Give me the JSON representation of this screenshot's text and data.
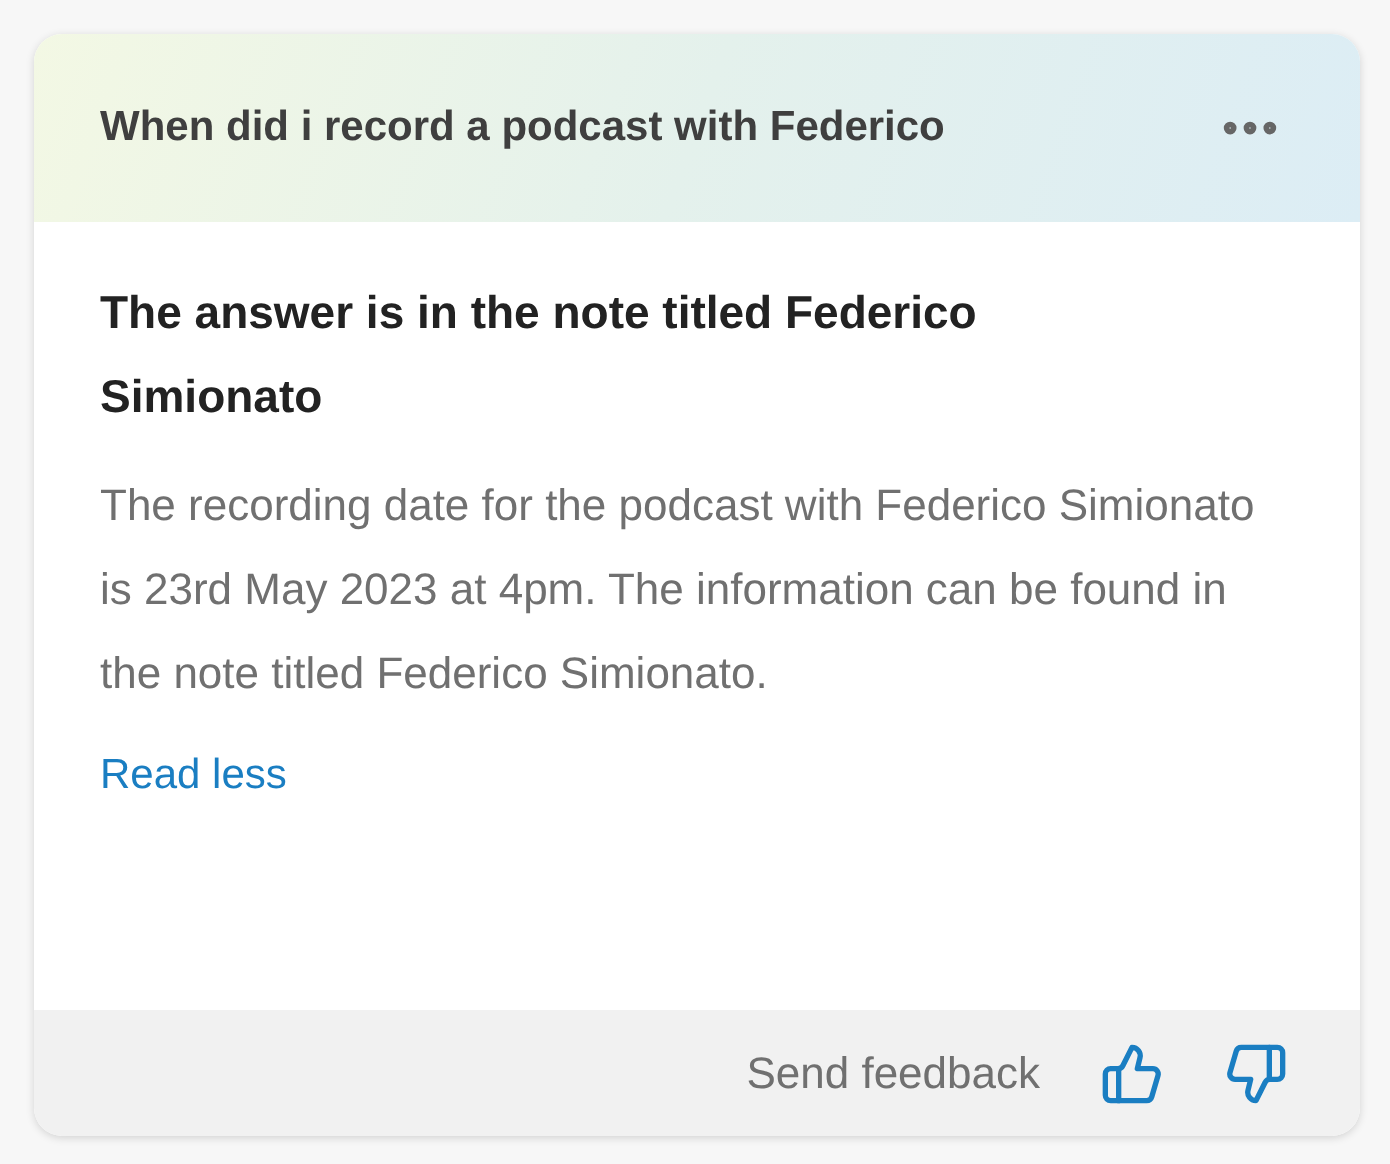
{
  "question": "When did i record a podcast with Federico",
  "answer": {
    "title": "The answer is in the note titled Federico Simionato",
    "text": "The recording date for the podcast with Federico Simionato is 23rd May 2023 at 4pm. The information can be found in the note titled Federico Simionato.",
    "link": "Read less"
  },
  "footer": {
    "feedback_label": "Send feedback"
  }
}
